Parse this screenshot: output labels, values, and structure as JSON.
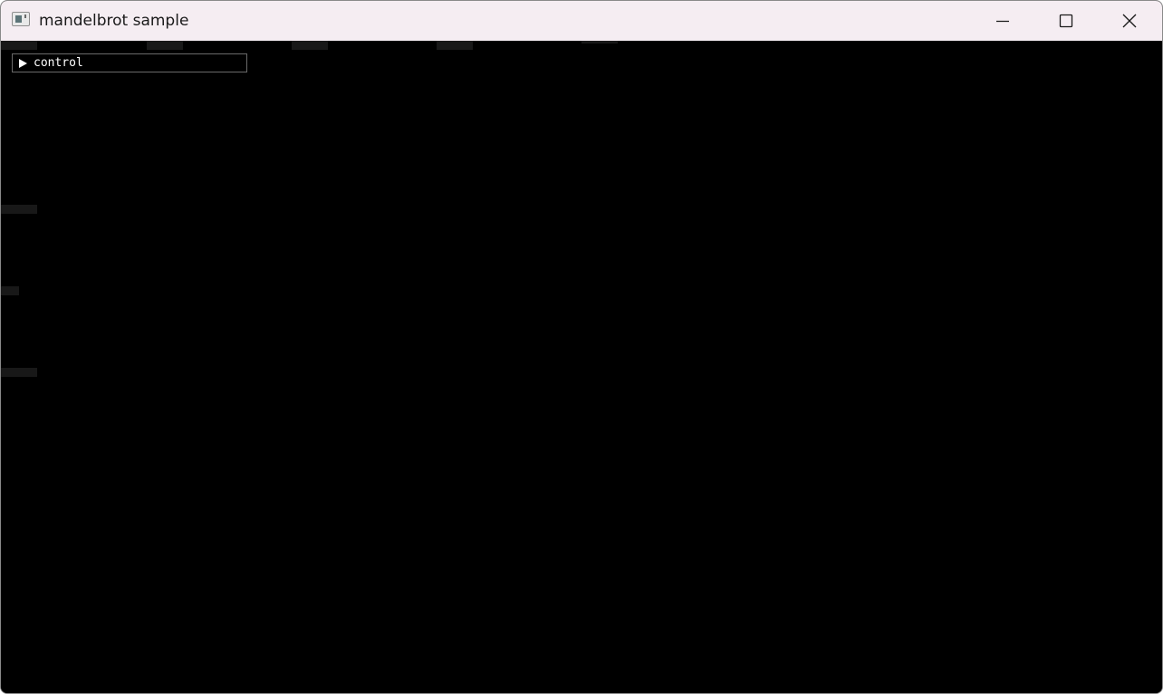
{
  "window": {
    "title": "mandelbrot sample",
    "app_icon": "terminal-window-icon",
    "controls": {
      "minimize_icon": "minimize-icon",
      "maximize_icon": "maximize-icon",
      "close_icon": "close-icon"
    }
  },
  "control_panel": {
    "label": "control",
    "expanded": false,
    "toggle_icon": "triangle-right-icon"
  },
  "colors": {
    "titlebar_bg": "#f5edf2",
    "canvas_bg": "#000000",
    "panel_border": "#6a6a6a",
    "tile": "#181818"
  }
}
